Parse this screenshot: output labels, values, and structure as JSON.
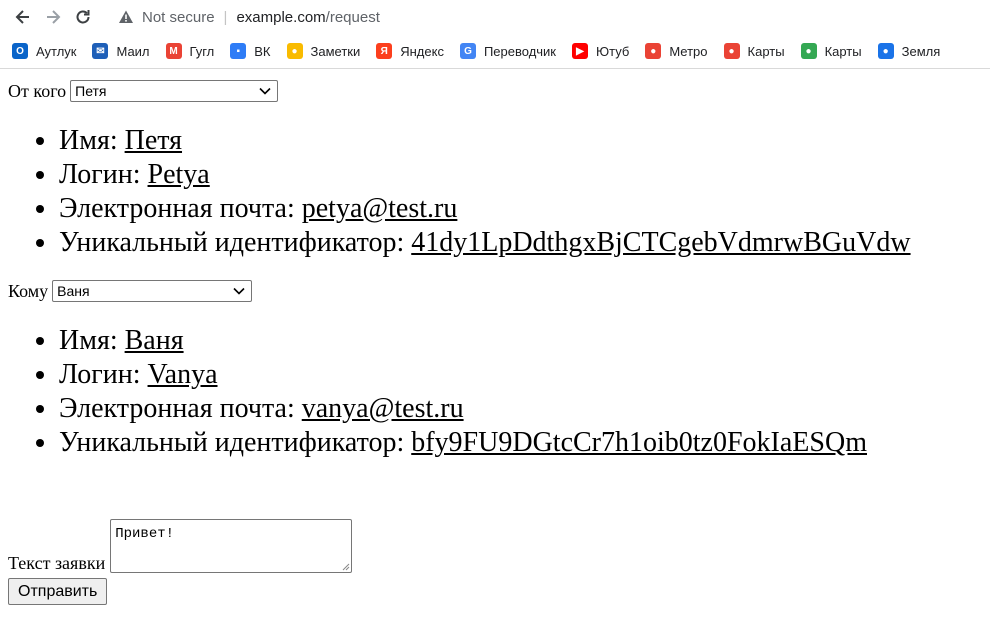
{
  "browser": {
    "security_label": "Not secure",
    "url_host": "example.com",
    "url_path": "/request",
    "bookmarks": [
      {
        "label": "Аутлук",
        "icon": "outlook-icon",
        "color": "#0a64c9",
        "glyph": "O"
      },
      {
        "label": "Маил",
        "icon": "mail-icon",
        "color": "#1e5fb8",
        "glyph": "✉"
      },
      {
        "label": "Гугл",
        "icon": "gmail-icon",
        "color": "#ea4335",
        "glyph": "M"
      },
      {
        "label": "ВК",
        "icon": "vk-icon",
        "color": "#2e7cf6",
        "glyph": "▪"
      },
      {
        "label": "Заметки",
        "icon": "notes-icon",
        "color": "#f9bb00",
        "glyph": "●"
      },
      {
        "label": "Яндекс",
        "icon": "yandex-icon",
        "color": "#fc3f1d",
        "glyph": "Я"
      },
      {
        "label": "Переводчик",
        "icon": "translate-icon",
        "color": "#4285f4",
        "glyph": "G"
      },
      {
        "label": "Ютуб",
        "icon": "youtube-icon",
        "color": "#ff0000",
        "glyph": "▶"
      },
      {
        "label": "Метро",
        "icon": "map-pin-icon",
        "color": "#ea4335",
        "glyph": "●"
      },
      {
        "label": "Карты",
        "icon": "map-pin-icon",
        "color": "#ea4335",
        "glyph": "●"
      },
      {
        "label": "Карты",
        "icon": "google-maps-icon",
        "color": "#34a853",
        "glyph": "●"
      },
      {
        "label": "Земля",
        "icon": "earth-icon",
        "color": "#1a73e8",
        "glyph": "●"
      }
    ]
  },
  "from": {
    "label": "От кого",
    "selected": "Петя",
    "fields": [
      {
        "label": "Имя: ",
        "value": "Петя"
      },
      {
        "label": "Логин: ",
        "value": "Petya"
      },
      {
        "label": "Электронная почта: ",
        "value": "petya@test.ru"
      },
      {
        "label": "Уникальный идентификатор: ",
        "value": "41dy1LpDdthgxBjCTCgebVdmrwBGuVdw"
      }
    ]
  },
  "to": {
    "label": "Кому",
    "selected": "Ваня",
    "fields": [
      {
        "label": "Имя: ",
        "value": "Ваня"
      },
      {
        "label": "Логин: ",
        "value": "Vanya"
      },
      {
        "label": "Электронная почта: ",
        "value": "vanya@test.ru"
      },
      {
        "label": "Уникальный идентификатор: ",
        "value": "bfy9FU9DGtcCr7h1oib0tz0FokIaESQm"
      }
    ]
  },
  "request": {
    "label": "Текст заявки",
    "text": "Привет!",
    "submit_label": "Отправить"
  }
}
